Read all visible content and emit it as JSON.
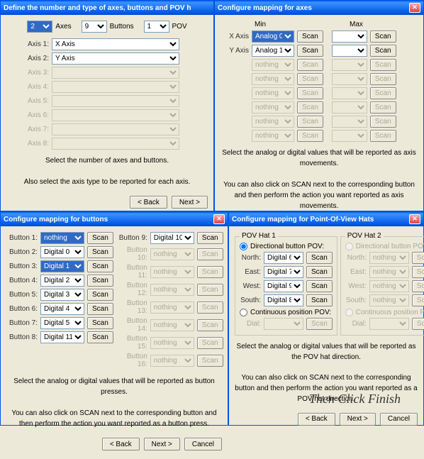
{
  "d1": {
    "title": "Define the number and type of axes, buttons and POV h",
    "counts": {
      "axes": "2",
      "axesLbl": "Axes",
      "buttons": "9",
      "buttonsLbl": "Buttons",
      "pov": "1",
      "povLbl": "POV"
    },
    "axisRows": [
      {
        "label": "Axis 1:",
        "value": "X Axis",
        "enabled": true
      },
      {
        "label": "Axis 2:",
        "value": "Y Axis",
        "enabled": true
      },
      {
        "label": "Axis 3:",
        "value": "",
        "enabled": false
      },
      {
        "label": "Axis 4:",
        "value": "",
        "enabled": false
      },
      {
        "label": "Axis 5:",
        "value": "",
        "enabled": false
      },
      {
        "label": "Axis 6:",
        "value": "",
        "enabled": false
      },
      {
        "label": "Axis 7:",
        "value": "",
        "enabled": false
      },
      {
        "label": "Axis 8:",
        "value": "",
        "enabled": false
      }
    ],
    "msg1": "Select the number of axes and buttons.",
    "msg2": "Also select the axis type to be reported for each axis."
  },
  "d2": {
    "title": "Configure mapping for axes",
    "minLbl": "Min",
    "maxLbl": "Max",
    "scanLbl": "Scan",
    "rows": [
      {
        "label": "X Axis",
        "min": "Analog 0",
        "minHi": true,
        "max": "",
        "enabled": true
      },
      {
        "label": "Y Axis",
        "min": "Analog 1",
        "minHi": false,
        "max": "",
        "enabled": true
      },
      {
        "label": "",
        "min": "nothing",
        "max": "",
        "enabled": false
      },
      {
        "label": "",
        "min": "nothing",
        "max": "",
        "enabled": false
      },
      {
        "label": "",
        "min": "nothing",
        "max": "",
        "enabled": false
      },
      {
        "label": "",
        "min": "nothing",
        "max": "",
        "enabled": false
      },
      {
        "label": "",
        "min": "nothing",
        "max": "",
        "enabled": false
      },
      {
        "label": "",
        "min": "nothing",
        "max": "",
        "enabled": false
      }
    ],
    "msg1": "Select the analog or digital values that will be reported as axis movements.",
    "msg2": "You can also click on SCAN next to the corresponding button and then perform the action you want reported as axis movements."
  },
  "d3": {
    "title": "Configure mapping for buttons",
    "scanLbl": "Scan",
    "left": [
      {
        "label": "Button 1:",
        "value": "nothing",
        "hi": true
      },
      {
        "label": "Button 2:",
        "value": "Digital 0",
        "hi": false
      },
      {
        "label": "Button 3:",
        "value": "Digital 1",
        "hi": true
      },
      {
        "label": "Button 4:",
        "value": "Digital 2",
        "hi": false
      },
      {
        "label": "Button 5:",
        "value": "Digital 3",
        "hi": false
      },
      {
        "label": "Button 6:",
        "value": "Digital 4",
        "hi": false
      },
      {
        "label": "Button 7:",
        "value": "Digital 5",
        "hi": false
      },
      {
        "label": "Button 8:",
        "value": "Digital 11",
        "hi": false
      }
    ],
    "right": [
      {
        "label": "Button 9:",
        "value": "Digital 10",
        "enabled": true
      },
      {
        "label": "Button 10:",
        "value": "nothing",
        "enabled": false
      },
      {
        "label": "Button 11:",
        "value": "nothing",
        "enabled": false
      },
      {
        "label": "Button 12:",
        "value": "nothing",
        "enabled": false
      },
      {
        "label": "Button 13:",
        "value": "nothing",
        "enabled": false
      },
      {
        "label": "Button 14:",
        "value": "nothing",
        "enabled": false
      },
      {
        "label": "Button 15:",
        "value": "nothing",
        "enabled": false
      },
      {
        "label": "Button 16:",
        "value": "nothing",
        "enabled": false
      }
    ],
    "msg1": "Select the analog or digital values that will be reported as button presses.",
    "msg2": "You can also click on SCAN next to the corresponding button and then perform the action you want reported as a button press."
  },
  "d4": {
    "title": "Configure mapping for Point-Of-View Hats",
    "scanLbl": "Scan",
    "hat1": {
      "legend": "POV Hat 1",
      "dirLbl": "Directional button POV:",
      "rows": [
        {
          "label": "North:",
          "value": "Digital 6"
        },
        {
          "label": "East:",
          "value": "Digital 7"
        },
        {
          "label": "West:",
          "value": "Digital 9"
        },
        {
          "label": "South:",
          "value": "Digital 8"
        }
      ],
      "contLbl": "Continuous position POV:",
      "dialLbl": "Dial:"
    },
    "hat2": {
      "legend": "POV Hat 2",
      "dirLbl": "Directional button POV",
      "rows": [
        {
          "label": "North:",
          "value": "nothing"
        },
        {
          "label": "East:",
          "value": "nothing"
        },
        {
          "label": "West:",
          "value": "nothing"
        },
        {
          "label": "South:",
          "value": "nothing"
        }
      ],
      "contLbl": "Continuous position POV",
      "dialLbl": "Dial:"
    },
    "msg1": "Select the analog or digital values that will be reported as the POV hat direction.",
    "msg2": "You can also click on SCAN next to the corresponding button and then perform the action you want reported as a POV hat direction."
  },
  "nav": {
    "back": "< Back",
    "next": "Next >",
    "cancel": "Cancel"
  },
  "overlay": "Then Click Finish"
}
